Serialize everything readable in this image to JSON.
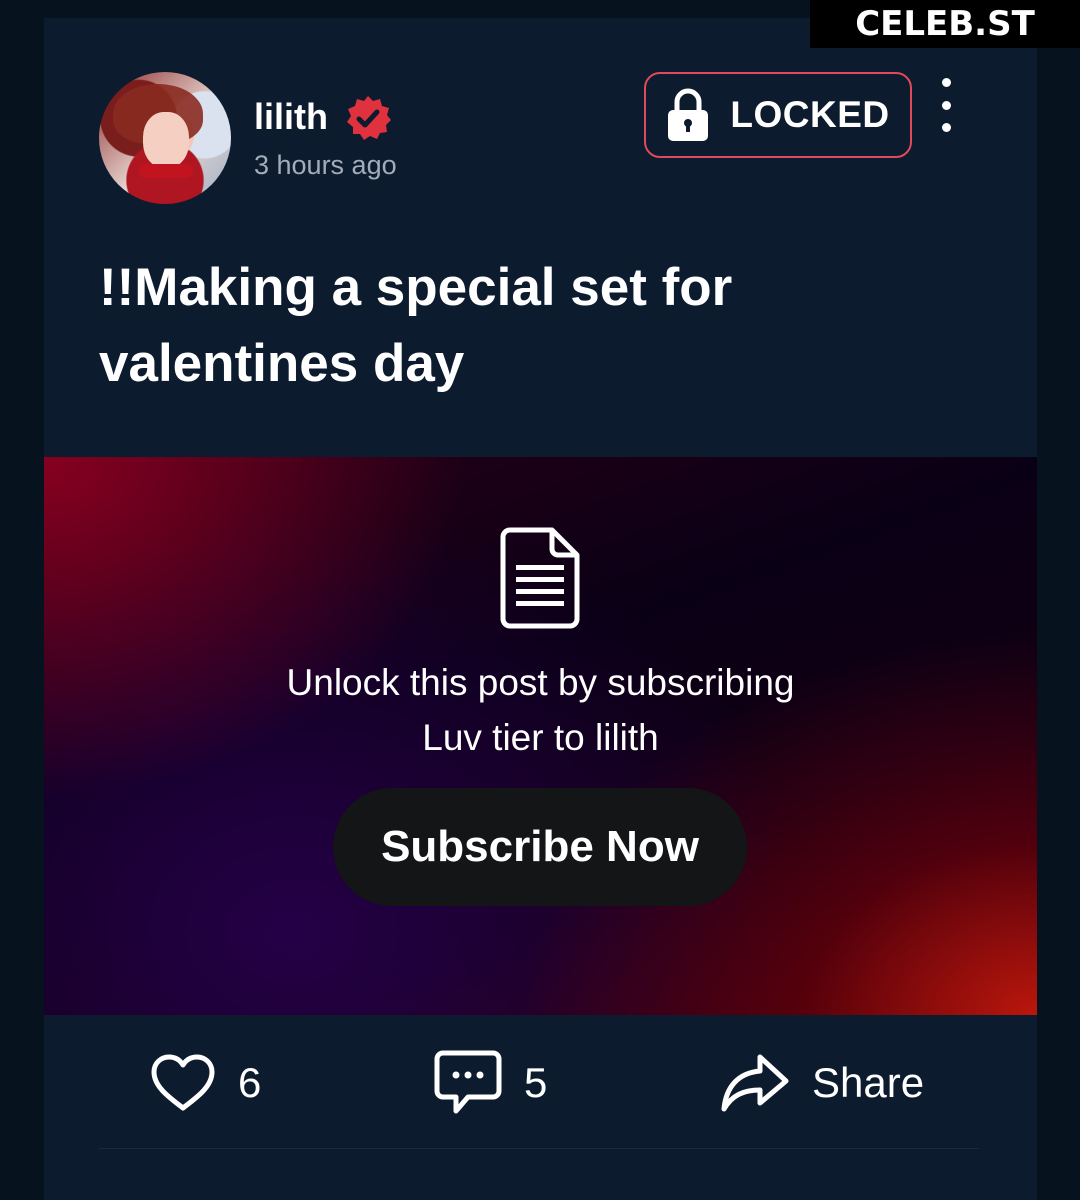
{
  "watermark": "CELEB.ST",
  "post": {
    "author": {
      "name": "lilith",
      "verified": true,
      "verified_color": "#e0313e",
      "timestamp": "3 hours ago"
    },
    "status_badge": {
      "icon": "lock-icon",
      "label": "LOCKED",
      "border_color": "#e04a5a"
    },
    "menu_icon": "more-vertical-icon",
    "title": "!!Making a special set for valentines day",
    "locked_content": {
      "icon": "document-icon",
      "message_line1": "Unlock this post by subscribing",
      "message_line2": "Luv tier to lilith",
      "button_label": "Subscribe Now"
    },
    "actions": {
      "like": {
        "icon": "heart-icon",
        "count": "6"
      },
      "comment": {
        "icon": "comment-icon",
        "count": "5"
      },
      "share": {
        "icon": "share-arrow-icon",
        "label": "Share"
      }
    }
  },
  "colors": {
    "page_background": "#07121f",
    "card_background": "#0c1b2e",
    "muted_text": "#a3acb9",
    "button_background": "#141517"
  }
}
